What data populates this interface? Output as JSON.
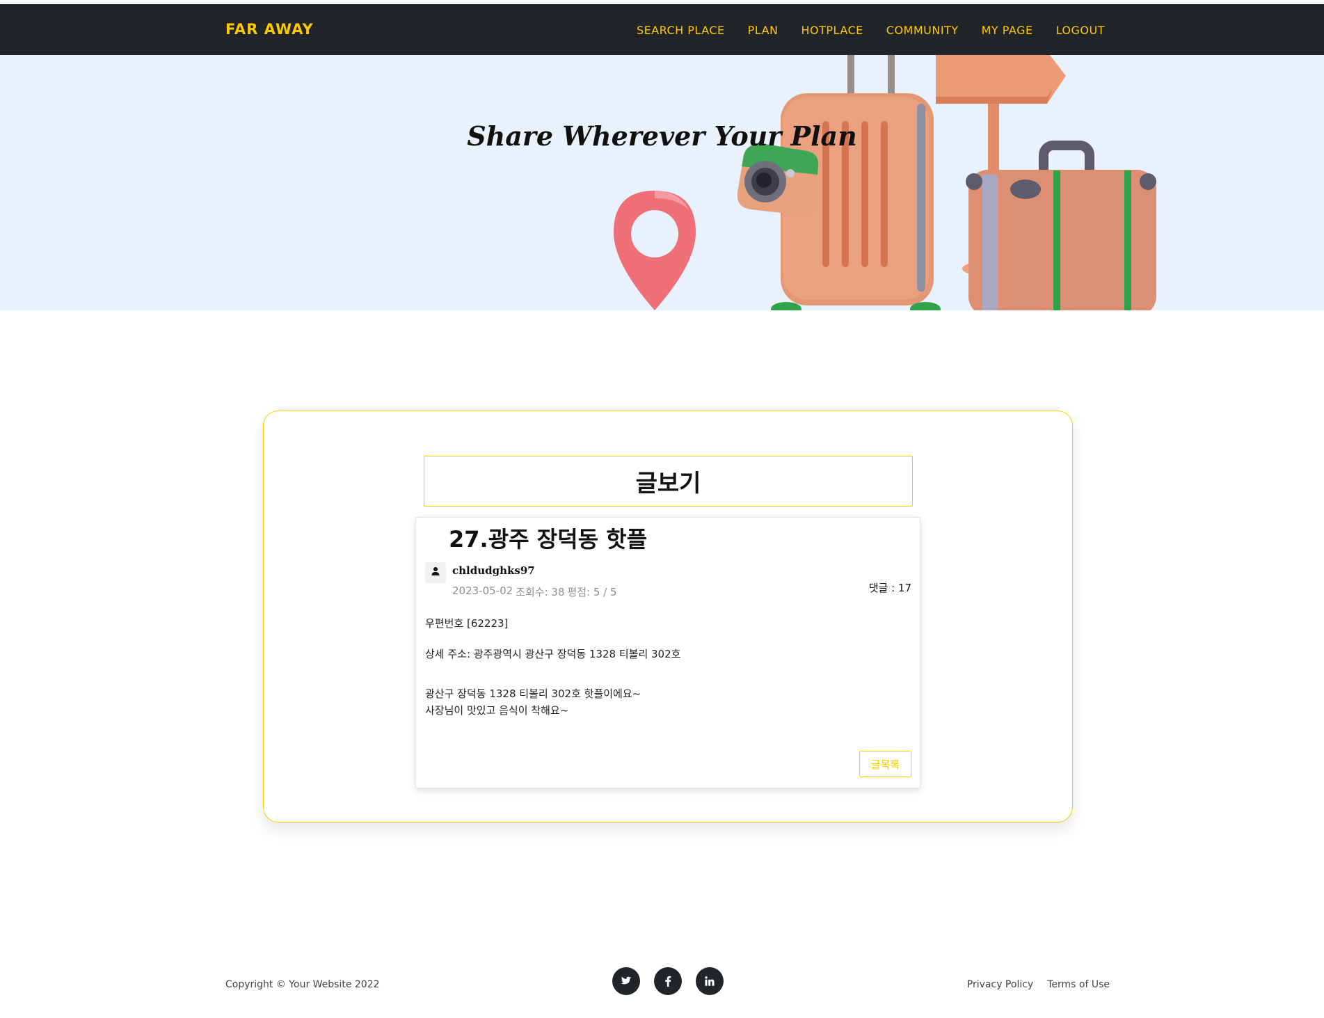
{
  "navbar": {
    "brand": "FAR AWAY",
    "links": [
      "SEARCH PLACE",
      "PLAN",
      "HOTPLACE",
      "COMMUNITY",
      "MY PAGE",
      "LOGOUT"
    ]
  },
  "hero": {
    "title": "Share Wherever Your Plan"
  },
  "view": {
    "header": "글보기"
  },
  "post": {
    "title": "27.광주 장덕동 핫플",
    "author": "chldudghks97",
    "date": "2023-05-02",
    "views": "조회수: 38",
    "rating": "평점: 5 / 5",
    "comment_count": "댓글 : 17",
    "postal": "우편번호 [62223]",
    "address": "상세 주소: 광주광역시 광산구 장덕동 1328 티볼리 302호",
    "body_line1": "광산구 장덕동 1328 티볼리 302호 핫플이에요~",
    "body_line2": "사장님이 맛있고 음식이 착해요~",
    "list_button": "글목록"
  },
  "footer": {
    "copyright": "Copyright © Your Website 2022",
    "socials": [
      "twitter-icon",
      "facebook-icon",
      "linkedin-icon"
    ],
    "links": [
      "Privacy Policy",
      "Terms of Use"
    ]
  },
  "colors": {
    "accent": "#ffc800",
    "navbar_bg": "#212529",
    "hero_bg": "#e8f1fc"
  }
}
